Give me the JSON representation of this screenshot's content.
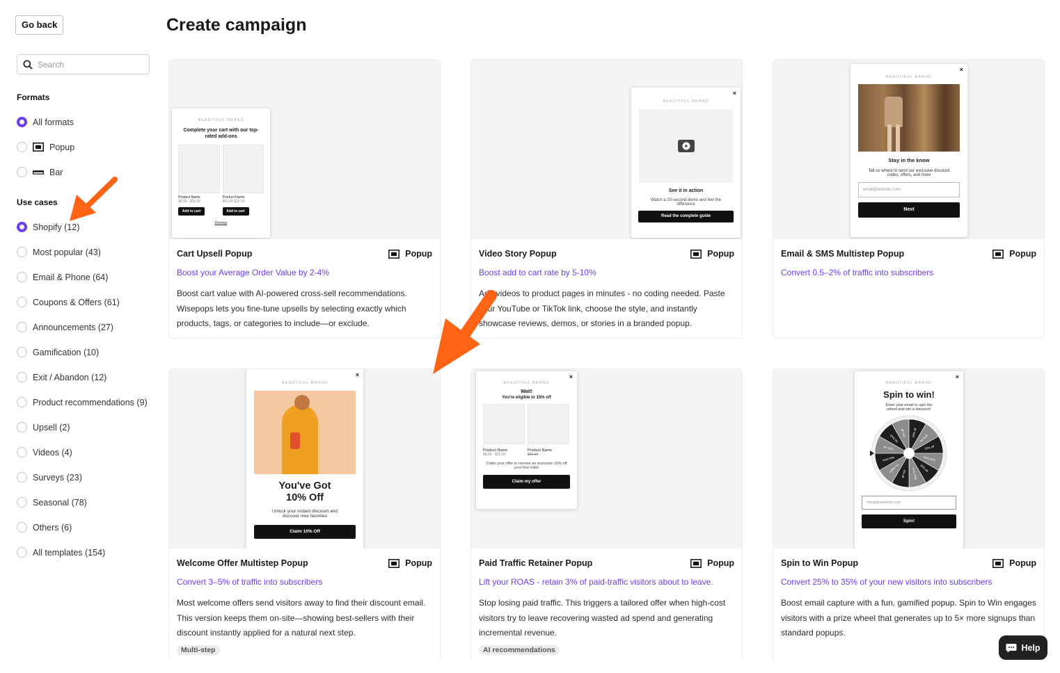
{
  "back_label": "Go back",
  "search": {
    "placeholder": "Search"
  },
  "page_title": "Create campaign",
  "formats_title": "Formats",
  "formats": [
    {
      "label": "All formats",
      "selected": true
    },
    {
      "label": "Popup",
      "selected": false
    },
    {
      "label": "Bar",
      "selected": false
    }
  ],
  "usecases_title": "Use cases",
  "usecases": [
    {
      "label": "Shopify (12)",
      "selected": true
    },
    {
      "label": "Most popular (43)",
      "selected": false
    },
    {
      "label": "Email & Phone (64)",
      "selected": false
    },
    {
      "label": "Coupons & Offers (61)",
      "selected": false
    },
    {
      "label": "Announcements (27)",
      "selected": false
    },
    {
      "label": "Gamification (10)",
      "selected": false
    },
    {
      "label": "Exit / Abandon (12)",
      "selected": false
    },
    {
      "label": "Product recommendations (9)",
      "selected": false
    },
    {
      "label": "Upsell (2)",
      "selected": false
    },
    {
      "label": "Videos (4)",
      "selected": false
    },
    {
      "label": "Surveys (23)",
      "selected": false
    },
    {
      "label": "Seasonal (78)",
      "selected": false
    },
    {
      "label": "Others (6)",
      "selected": false
    },
    {
      "label": "All templates (154)",
      "selected": false
    }
  ],
  "accent_color": "#6c3df0",
  "arrow_color": "#ff6414",
  "cards": [
    {
      "title": "Cart Upsell Popup",
      "format": "Popup",
      "link": "Boost your Average Order Value by 2-4%",
      "desc": "Boost cart value with AI-powered cross-sell recommendations. Wisepops lets you fine-tune upsells by selecting exactly which products, tags, or categories to include—or exclude.",
      "preview": {
        "brand": "BEAUTIFUL BRAND",
        "heading": "Complete your cart with our top-rated add-ons",
        "p1_name": "Product Name",
        "p1_price": "$8.99 - $25.00",
        "p2_name": "Product Name",
        "p2_price": "$50.00 $25.00",
        "btn": "Add to cart",
        "dismiss": "Dismiss"
      }
    },
    {
      "title": "Video Story Popup",
      "format": "Popup",
      "link": "Boost add to cart rate by 5-10%",
      "desc": "Add videos to product pages in minutes - no coding needed. Paste your YouTube or TikTok link, choose the style, and instantly showcase reviews, demos, or stories in a branded popup.",
      "preview": {
        "brand": "BEAUTIFUL BRAND",
        "heading": "See it in action",
        "sub": "Watch a 20-second demo and feel the difference",
        "btn": "Read the complete guide"
      }
    },
    {
      "title": "Email & SMS Multistep Popup",
      "format": "Popup",
      "link": "Convert 0.5–2% of traffic into subscribers",
      "desc": "",
      "preview": {
        "brand": "BEAUTIFUL BRAND",
        "heading": "Stay in the know",
        "sub": "Tell us where to send our exclusive discount codes, offers, and more",
        "input": "email@website.com",
        "btn": "Next"
      }
    },
    {
      "title": "Welcome Offer Multistep Popup",
      "format": "Popup",
      "link": "Convert 3–5% of traffic into subscribers",
      "desc": "Most welcome offers send visitors away to find their discount email. This version keeps them on-site—showing best-sellers with their discount instantly applied for a natural next step.",
      "tag": "Multi-step",
      "preview": {
        "brand": "BEAUTIFUL BRAND",
        "heading": "You've Got 10% Off",
        "sub": "Unlock your instant discount and discover new favorites",
        "btn": "Claim 10% Off"
      }
    },
    {
      "title": "Paid Traffic Retainer Popup",
      "format": "Popup",
      "link": "Lift your ROAS - retain 3% of paid-traffic visitors about to leave.",
      "desc": "Stop losing paid traffic. This triggers a tailored offer when high-cost visitors try to leave recovering wasted ad spend and generating incremental revenue.",
      "tag": "AI recommendations",
      "preview": {
        "brand": "BEAUTIFUL BRAND",
        "heading": "Wait!",
        "heading2": "You're eligible to 15% off",
        "p1_name": "Product Name",
        "p1_price": "$8.99 - $25.00",
        "p2_name": "Product Name",
        "p2_price": "$50.00",
        "sub": "Claim your offer to receive an exclusive 15% off your first order",
        "btn": "Claim my offer"
      }
    },
    {
      "title": "Spin to Win Popup",
      "format": "Popup",
      "link": "Convert 25% to 35% of your new visitors into subscribers",
      "desc": "Boost email capture with a fun, gamified popup. Spin to Win engages visitors with a prize wheel that generates up to 5× more signups than standard popups.",
      "preview": {
        "brand": "BEAUTIFUL BRAND",
        "heading": "Spin to win!",
        "sub": "Enter your email to spin the wheel and win a discount!",
        "input": "email@website.com",
        "btn": "Spin!",
        "wheel": [
          "10% off",
          "No luck",
          "15% off",
          "Next time",
          "20% off",
          "Free ship",
          "5% off",
          "Try again",
          "Next time",
          "25% off",
          "No luck",
          "5% off"
        ]
      }
    }
  ],
  "help_label": "Help"
}
